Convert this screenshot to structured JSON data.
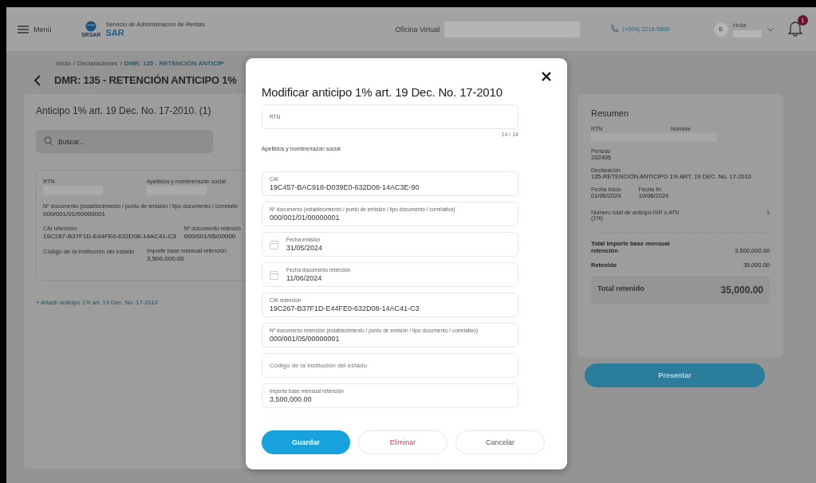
{
  "header": {
    "menu": "Menú",
    "logo_caption": "SRSAR",
    "org_name": "Servicio de Administración de Rentas",
    "org_short": "SAR",
    "office_label": "Oficina Virtual",
    "phone": "(+504) 2216-5800",
    "avatar": "E",
    "greeting": "Hola",
    "notifications": "1"
  },
  "breadcrumb": {
    "separator": "/",
    "items": [
      "Inicio",
      "Declaraciones",
      "DMR: 135 - RETENCIÓN ANTICIP"
    ]
  },
  "page_title": "DMR: 135 - RETENCIÓN ANTICIPO 1%",
  "list_card": {
    "title": "Anticipo 1% art. 19 Dec. No. 17-2010. (1)",
    "search": {
      "placeholder": "Buscar..."
    },
    "rows": [
      [
        {
          "label": "RTN",
          "kind": "masked"
        },
        {
          "label": "Apellidos y nombre/razón social",
          "kind": "masked"
        }
      ],
      [
        {
          "label": "Nº documento (establecimiento / punto de emisión / tipo documento / correlativ",
          "value": "000/001/01/00000001",
          "kind": "text"
        }
      ],
      [
        {
          "label": "CAI retención",
          "value": "19C267-B37F1D-E44FE0-632D08-14AC41-C3",
          "kind": "text"
        },
        {
          "label": "Nº documento retenció",
          "value": "000/001/05/00000",
          "kind": "text"
        }
      ],
      [
        {
          "label": "Código de la institución del estado",
          "kind": "label"
        },
        {
          "label": "Importe base mensual retención",
          "value": "3,500,000.00",
          "kind": "text"
        }
      ]
    ],
    "add_link": "+ Añadir anticipo 1% art. 19 Dec. No. 17-2010"
  },
  "summary": {
    "title": "Resumen",
    "party": [
      {
        "label": "RTN"
      },
      {
        "label": "Nombre"
      }
    ],
    "items": [
      {
        "label": "Período",
        "value": "202405"
      },
      {
        "label": "Declaración",
        "value": "135-RETENCIÓN ANTICIPO 1% ART. 19 DEC. No. 17-2010"
      }
    ],
    "dates": [
      {
        "label": "Fecha Inicio",
        "value": "01/06/2024"
      },
      {
        "label": "Fecha fin",
        "value": "10/06/2024"
      }
    ],
    "count": {
      "label": "Número total de anticipo ISR o ATN (1%)",
      "value": "1"
    },
    "totals": [
      {
        "label": "Total importe base mensual retención",
        "value": "3,500,000.00"
      },
      {
        "label": "Retenido",
        "value": "35,000.00"
      }
    ],
    "grand_total": {
      "label": "Total retenido",
      "value": "35,000.00"
    },
    "submit": "Presentar"
  },
  "modal": {
    "title": "Modificar anticipo 1% art. 19 Dec. No. 17-2010",
    "fields": [
      {
        "kind": "input",
        "label": "RTN",
        "counter": "14 / 14"
      },
      {
        "kind": "heading",
        "label": "Apellidos y nombre/razón social"
      },
      {
        "kind": "input",
        "label": "CAI",
        "value": "19C457-BAC918-D039E0-632D08-14AC3E-90"
      },
      {
        "kind": "input",
        "label": "Nº documento (establecimiento / punto de emisión / tipo documento / correlativo)",
        "value": "000/001/01/00000001"
      },
      {
        "kind": "date",
        "label": "Fecha emisión",
        "value": "31/05/2024"
      },
      {
        "kind": "date",
        "label": "Fecha documento retención",
        "value": "11/06/2024"
      },
      {
        "kind": "input",
        "label": "CAI retención",
        "value": "19C267-B37F1D-E44FE0-632D08-14AC41-C3"
      },
      {
        "kind": "input",
        "label": "Nº documento retención (establecimiento / punto de emisión / tipo documento / correlativo)",
        "value": "000/001/05/00000001"
      },
      {
        "kind": "input",
        "placeholder": "Código de la institución del estado"
      },
      {
        "kind": "input",
        "label": "Importe base mensual retención",
        "value": "3,500,000.00"
      }
    ],
    "buttons": [
      {
        "label": "Guardar",
        "kind": "primary"
      },
      {
        "label": "Eliminar",
        "kind": "danger"
      },
      {
        "label": "Cancelar",
        "kind": "plain"
      }
    ]
  }
}
